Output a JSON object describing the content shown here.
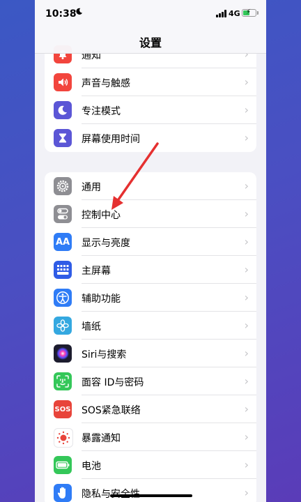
{
  "status_bar": {
    "time": "10:38",
    "network": "4G"
  },
  "nav": {
    "title": "设置"
  },
  "group1": [
    {
      "label": "通知",
      "icon": "bell-icon",
      "color": "#f2453d"
    },
    {
      "label": "声音与触感",
      "icon": "speaker-icon",
      "color": "#f2453d"
    },
    {
      "label": "专注模式",
      "icon": "moon-icon",
      "color": "#5b56d6"
    },
    {
      "label": "屏幕使用时间",
      "icon": "hourglass-icon",
      "color": "#5b56d6"
    }
  ],
  "group2": [
    {
      "label": "通用",
      "icon": "gear-icon",
      "color": "#8e8e93"
    },
    {
      "label": "控制中心",
      "icon": "toggles-icon",
      "color": "#8e8e93"
    },
    {
      "label": "显示与亮度",
      "icon": "text-size-icon",
      "color": "#2f7cf6",
      "glyph": "AA"
    },
    {
      "label": "主屏幕",
      "icon": "home-grid-icon",
      "color": "#2f5ce6"
    },
    {
      "label": "辅助功能",
      "icon": "accessibility-icon",
      "color": "#2f7cf6"
    },
    {
      "label": "墙纸",
      "icon": "flower-icon",
      "color": "#34a8e0"
    },
    {
      "label": "Siri与搜索",
      "icon": "siri-icon",
      "color": "#1c1c2e"
    },
    {
      "label": "面容 ID与密码",
      "icon": "face-id-icon",
      "color": "#34c759"
    },
    {
      "label": "SOS紧急联络",
      "icon": "sos-icon",
      "color": "#e8443a",
      "glyph": "SOS"
    },
    {
      "label": "暴露通知",
      "icon": "exposure-icon",
      "color": "#ffffff"
    },
    {
      "label": "电池",
      "icon": "battery-icon",
      "color": "#34c759"
    },
    {
      "label": "隐私与安全性",
      "icon": "hand-icon",
      "color": "#2f7cf6"
    }
  ],
  "annotation": {
    "color": "#e53030"
  }
}
